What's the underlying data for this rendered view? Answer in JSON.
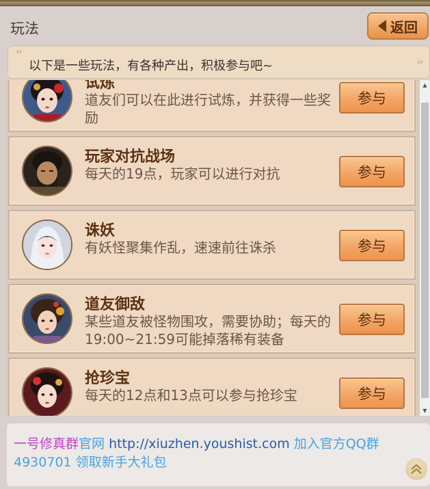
{
  "header": {
    "title": "玩法",
    "back_label": "返回"
  },
  "notice": {
    "open_quote": "“",
    "text": "以下是一些玩法，有各种产出，积极参与吧~",
    "close_quote": "”"
  },
  "activities": [
    {
      "title": "试炼",
      "desc": "道友们可以在此进行试炼，并获得一些奖励",
      "join_label": "参与"
    },
    {
      "title": "玩家对抗战场",
      "desc": "每天的19点，玩家可以进行对抗",
      "join_label": "参与"
    },
    {
      "title": "诛妖",
      "desc": "有妖怪聚集作乱，速速前往诛杀",
      "join_label": "参与"
    },
    {
      "title": "道友御敌",
      "desc": "某些道友被怪物围攻，需要协助；每天的19:00~21:59可能掉落稀有装备",
      "join_label": "参与"
    },
    {
      "title": "抢珍宝",
      "desc": "每天的12点和13点可以参与抢珍宝",
      "join_label": "参与"
    }
  ],
  "footer": {
    "part1": "一号修真群",
    "part2": "官网 ",
    "url": "http://xiuzhen.youshist.com",
    "part3": " 加入官方QQ群",
    "qq_group": "4930701",
    "part4": " 领取新手大礼包"
  },
  "scroll": {
    "up_arrow": "▲",
    "down_arrow": "▼",
    "top_icon": "double-chevron-up-icon"
  }
}
